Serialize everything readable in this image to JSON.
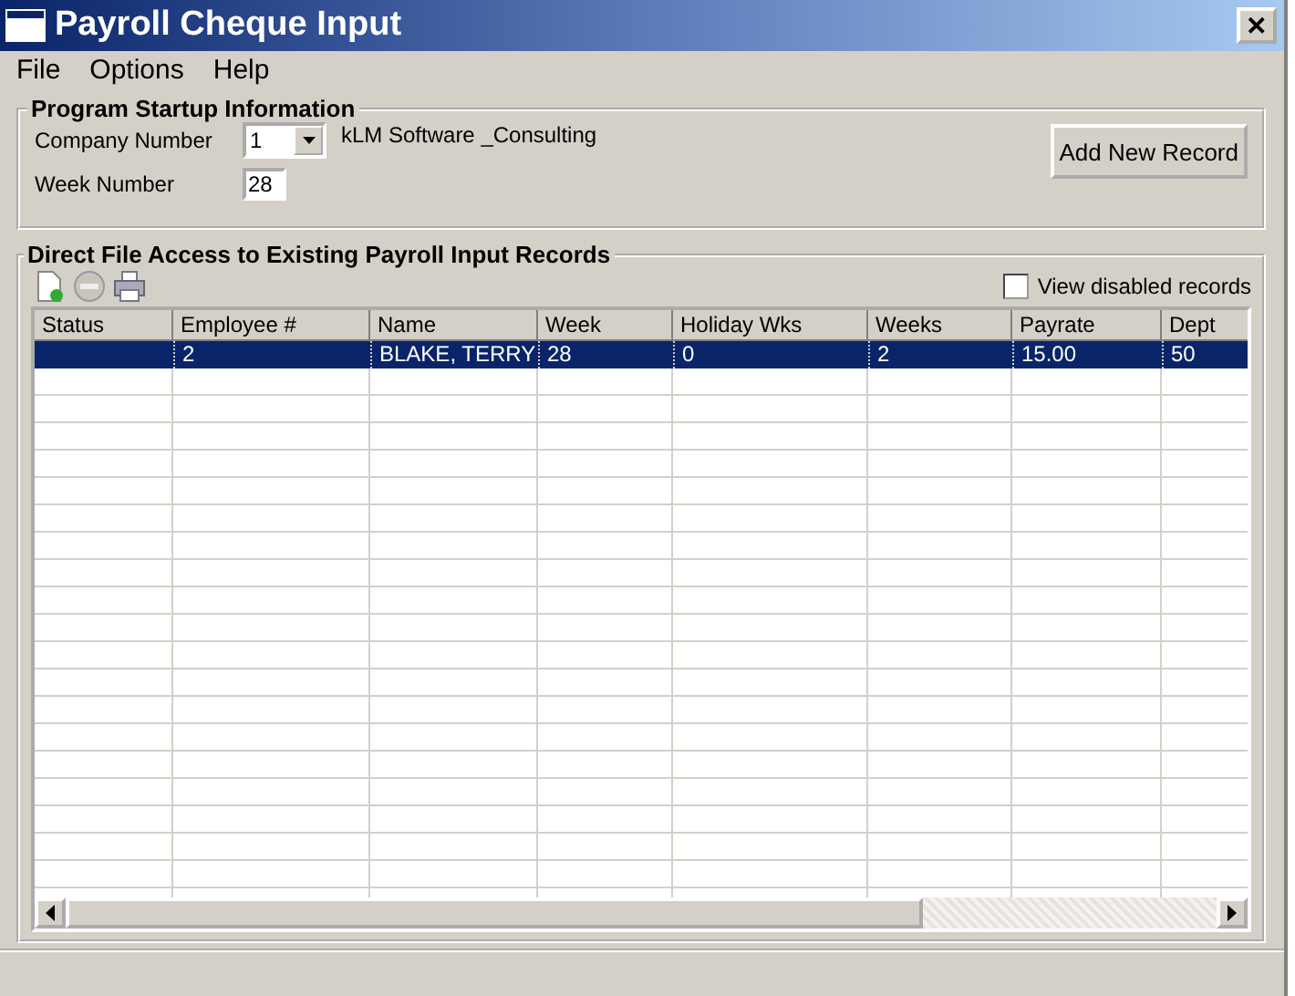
{
  "window": {
    "title": "Payroll Cheque Input",
    "close": "✕"
  },
  "menu": [
    "File",
    "Options",
    "Help"
  ],
  "startup": {
    "title": "Program Startup Information",
    "company_label": "Company Number",
    "company_value": "1",
    "company_name": "kLM Software _Consulting",
    "week_label": "Week Number",
    "week_value": "28",
    "add_button": "Add New Record"
  },
  "records": {
    "title": "Direct File Access to Existing Payroll Input Records",
    "view_disabled": {
      "label": "View disabled records",
      "checked": false
    },
    "columns": [
      "Status",
      "Employee #",
      "Name",
      "Week",
      "Holiday Wks",
      "Weeks",
      "Payrate",
      "Dept"
    ],
    "rows": [
      {
        "cells": [
          "",
          "2",
          "BLAKE, TERRY",
          "28",
          "0",
          "2",
          "15.00",
          "50"
        ],
        "selected": true
      }
    ]
  }
}
